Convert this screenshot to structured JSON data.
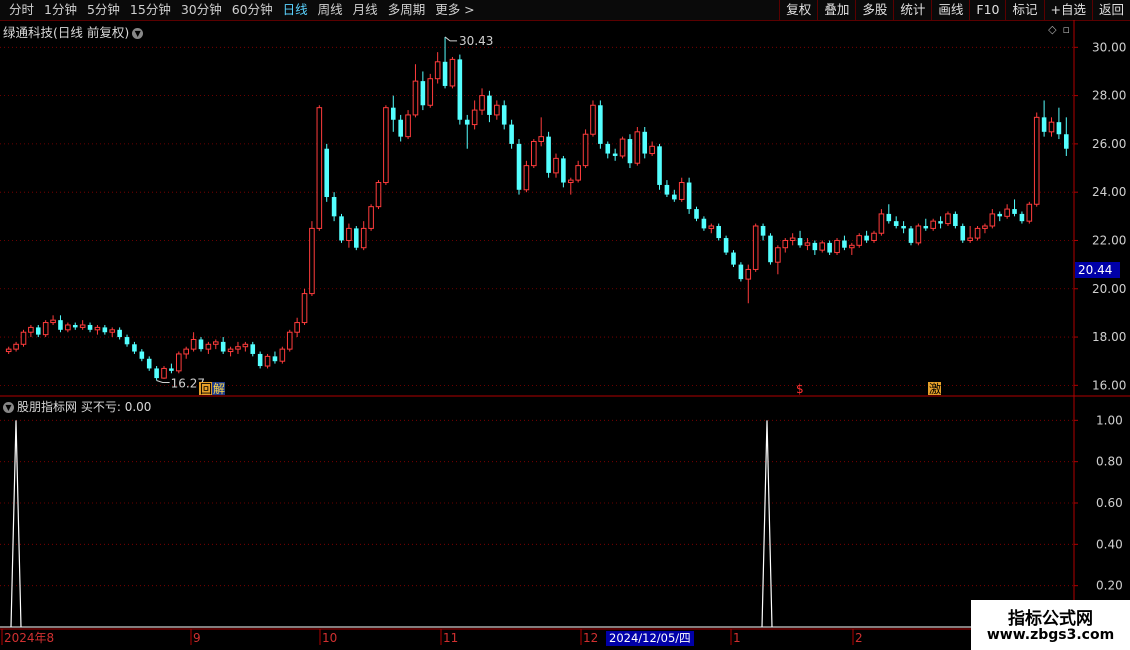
{
  "toolbar": {
    "periods": [
      "分时",
      "1分钟",
      "5分钟",
      "15分钟",
      "30分钟",
      "60分钟",
      "日线",
      "周线",
      "月线",
      "多周期",
      "更多 >"
    ],
    "active_period": "日线",
    "right_buttons": [
      "复权",
      "叠加",
      "多股",
      "统计",
      "画线",
      "F10",
      "标记",
      "+自选",
      "返回"
    ]
  },
  "chart_header": {
    "title": "绿通科技(日线 前复权)"
  },
  "indicator_header": {
    "name": "股朋指标网",
    "label": "买不亏:",
    "value": "0.00"
  },
  "price_axis": {
    "ticks": [
      "30.00",
      "28.00",
      "26.00",
      "24.00",
      "22.00",
      "20.00",
      "18.00",
      "16.00"
    ]
  },
  "indicator_axis": {
    "ticks": [
      "1.00",
      "0.80",
      "0.60",
      "0.40",
      "0.20"
    ]
  },
  "current_price": "20.44",
  "annotations": {
    "high": "30.43",
    "low": "16.27"
  },
  "markers": {
    "hui": "回",
    "jie": "解",
    "dollar": "$",
    "ji": "激"
  },
  "date_axis": [
    "2024年8",
    "9",
    "10",
    "11",
    "12",
    "1",
    "2"
  ],
  "crosshair_date": "2024/12/05/四",
  "watermark": {
    "line1": "指标公式网",
    "line2": "www.zbgs3.com"
  },
  "colors": {
    "up": "#ff3c3c",
    "down": "#54ffff",
    "grid": "#8a0000",
    "active": "#5ad2ff",
    "badge": "#0000a8"
  },
  "chart_data": {
    "type": "candlestick",
    "price_range": [
      15.6,
      30.8
    ],
    "indicator_range": [
      0,
      1.05
    ],
    "candles": [
      [
        17.4,
        17.6,
        17.3,
        17.5
      ],
      [
        17.5,
        17.8,
        17.4,
        17.7
      ],
      [
        17.7,
        18.3,
        17.6,
        18.2
      ],
      [
        18.2,
        18.5,
        18.0,
        18.4
      ],
      [
        18.4,
        18.5,
        18.0,
        18.1
      ],
      [
        18.1,
        18.7,
        18.0,
        18.6
      ],
      [
        18.6,
        18.9,
        18.5,
        18.7
      ],
      [
        18.7,
        18.9,
        18.2,
        18.3
      ],
      [
        18.3,
        18.6,
        18.2,
        18.5
      ],
      [
        18.5,
        18.6,
        18.3,
        18.4
      ],
      [
        18.4,
        18.7,
        18.3,
        18.5
      ],
      [
        18.5,
        18.6,
        18.2,
        18.3
      ],
      [
        18.3,
        18.5,
        18.1,
        18.4
      ],
      [
        18.4,
        18.5,
        18.1,
        18.2
      ],
      [
        18.2,
        18.4,
        18.0,
        18.3
      ],
      [
        18.3,
        18.4,
        17.9,
        18.0
      ],
      [
        18.0,
        18.1,
        17.6,
        17.7
      ],
      [
        17.7,
        17.8,
        17.3,
        17.4
      ],
      [
        17.4,
        17.5,
        17.0,
        17.1
      ],
      [
        17.1,
        17.2,
        16.6,
        16.7
      ],
      [
        16.7,
        16.8,
        16.2,
        16.3
      ],
      [
        16.3,
        16.8,
        16.27,
        16.7
      ],
      [
        16.7,
        16.9,
        16.5,
        16.6
      ],
      [
        16.6,
        17.4,
        16.5,
        17.3
      ],
      [
        17.3,
        17.6,
        17.1,
        17.5
      ],
      [
        17.5,
        18.2,
        17.4,
        17.9
      ],
      [
        17.9,
        18.0,
        17.4,
        17.5
      ],
      [
        17.5,
        17.8,
        17.3,
        17.7
      ],
      [
        17.7,
        17.9,
        17.5,
        17.8
      ],
      [
        17.8,
        18.0,
        17.3,
        17.4
      ],
      [
        17.4,
        17.6,
        17.2,
        17.5
      ],
      [
        17.5,
        17.8,
        17.3,
        17.6
      ],
      [
        17.6,
        17.8,
        17.4,
        17.7
      ],
      [
        17.7,
        17.8,
        17.2,
        17.3
      ],
      [
        17.3,
        17.4,
        16.7,
        16.8
      ],
      [
        16.8,
        17.3,
        16.7,
        17.2
      ],
      [
        17.2,
        17.4,
        16.9,
        17.0
      ],
      [
        17.0,
        17.6,
        16.9,
        17.5
      ],
      [
        17.5,
        18.3,
        17.4,
        18.2
      ],
      [
        18.2,
        18.8,
        18.0,
        18.6
      ],
      [
        18.6,
        20.0,
        18.5,
        19.8
      ],
      [
        19.8,
        22.8,
        19.7,
        22.5
      ],
      [
        22.5,
        27.6,
        22.4,
        27.5
      ],
      [
        25.8,
        26.0,
        23.6,
        23.8
      ],
      [
        23.8,
        24.0,
        22.8,
        23.0
      ],
      [
        23.0,
        23.1,
        21.9,
        22.0
      ],
      [
        22.0,
        22.7,
        21.7,
        22.5
      ],
      [
        22.5,
        22.6,
        21.6,
        21.7
      ],
      [
        21.7,
        22.8,
        21.6,
        22.5
      ],
      [
        22.5,
        23.5,
        22.4,
        23.4
      ],
      [
        23.4,
        24.5,
        23.3,
        24.4
      ],
      [
        24.4,
        27.6,
        24.3,
        27.5
      ],
      [
        27.5,
        28.0,
        26.5,
        27.0
      ],
      [
        27.0,
        27.2,
        26.1,
        26.3
      ],
      [
        26.3,
        27.4,
        26.2,
        27.2
      ],
      [
        27.2,
        29.3,
        27.1,
        28.6
      ],
      [
        28.6,
        29.0,
        27.4,
        27.6
      ],
      [
        27.6,
        28.9,
        27.5,
        28.7
      ],
      [
        28.7,
        29.8,
        28.5,
        29.4
      ],
      [
        29.4,
        30.43,
        28.3,
        28.4
      ],
      [
        28.4,
        29.6,
        28.3,
        29.5
      ],
      [
        29.5,
        29.7,
        26.8,
        27.0
      ],
      [
        27.0,
        27.2,
        25.8,
        26.8
      ],
      [
        26.8,
        27.8,
        26.6,
        27.4
      ],
      [
        27.4,
        28.3,
        27.2,
        28.0
      ],
      [
        28.0,
        28.2,
        26.9,
        27.2
      ],
      [
        27.2,
        27.8,
        27.0,
        27.6
      ],
      [
        27.6,
        27.8,
        26.6,
        26.8
      ],
      [
        26.8,
        27.0,
        25.8,
        26.0
      ],
      [
        26.0,
        26.2,
        23.9,
        24.1
      ],
      [
        24.1,
        25.3,
        24.0,
        25.1
      ],
      [
        25.1,
        26.2,
        25.0,
        26.1
      ],
      [
        26.1,
        27.1,
        25.9,
        26.3
      ],
      [
        26.3,
        26.5,
        24.6,
        24.8
      ],
      [
        24.8,
        25.6,
        24.6,
        25.4
      ],
      [
        25.4,
        25.5,
        24.2,
        24.4
      ],
      [
        24.4,
        24.6,
        23.9,
        24.5
      ],
      [
        24.5,
        25.3,
        24.4,
        25.1
      ],
      [
        25.1,
        26.6,
        25.0,
        26.4
      ],
      [
        26.4,
        27.8,
        26.3,
        27.6
      ],
      [
        27.6,
        27.8,
        25.8,
        26.0
      ],
      [
        26.0,
        26.1,
        25.4,
        25.6
      ],
      [
        25.6,
        25.8,
        25.3,
        25.5
      ],
      [
        25.5,
        26.3,
        25.4,
        26.2
      ],
      [
        26.2,
        26.4,
        25.0,
        25.2
      ],
      [
        25.2,
        26.7,
        25.1,
        26.5
      ],
      [
        26.5,
        26.7,
        25.4,
        25.6
      ],
      [
        25.6,
        26.1,
        25.5,
        25.9
      ],
      [
        25.9,
        26.0,
        24.1,
        24.3
      ],
      [
        24.3,
        24.5,
        23.8,
        23.9
      ],
      [
        23.9,
        24.1,
        23.6,
        23.7
      ],
      [
        23.7,
        24.6,
        23.6,
        24.4
      ],
      [
        24.4,
        24.6,
        23.1,
        23.3
      ],
      [
        23.3,
        23.4,
        22.8,
        22.9
      ],
      [
        22.9,
        23.0,
        22.4,
        22.5
      ],
      [
        22.5,
        22.7,
        22.3,
        22.6
      ],
      [
        22.6,
        22.7,
        22.0,
        22.1
      ],
      [
        22.1,
        22.2,
        21.4,
        21.5
      ],
      [
        21.5,
        21.6,
        20.9,
        21.0
      ],
      [
        21.0,
        21.1,
        20.3,
        20.4
      ],
      [
        20.4,
        21.0,
        19.4,
        20.8
      ],
      [
        20.8,
        22.7,
        20.7,
        22.6
      ],
      [
        22.6,
        22.7,
        22.0,
        22.2
      ],
      [
        22.2,
        22.3,
        21.0,
        21.1
      ],
      [
        21.1,
        21.8,
        20.6,
        21.7
      ],
      [
        21.7,
        22.1,
        21.5,
        22.0
      ],
      [
        22.0,
        22.3,
        21.8,
        22.1
      ],
      [
        22.1,
        22.4,
        21.7,
        21.8
      ],
      [
        21.8,
        22.1,
        21.6,
        21.9
      ],
      [
        21.9,
        22.0,
        21.4,
        21.6
      ],
      [
        21.6,
        22.0,
        21.5,
        21.9
      ],
      [
        21.9,
        22.0,
        21.4,
        21.5
      ],
      [
        21.5,
        22.1,
        21.4,
        22.0
      ],
      [
        22.0,
        22.2,
        21.6,
        21.7
      ],
      [
        21.7,
        21.9,
        21.4,
        21.8
      ],
      [
        21.8,
        22.3,
        21.7,
        22.2
      ],
      [
        22.2,
        22.4,
        21.9,
        22.0
      ],
      [
        22.0,
        22.4,
        21.9,
        22.3
      ],
      [
        22.3,
        23.3,
        22.2,
        23.1
      ],
      [
        23.1,
        23.5,
        22.7,
        22.8
      ],
      [
        22.8,
        23.0,
        22.5,
        22.6
      ],
      [
        22.6,
        22.8,
        22.3,
        22.5
      ],
      [
        22.5,
        22.6,
        21.8,
        21.9
      ],
      [
        21.9,
        22.7,
        21.8,
        22.6
      ],
      [
        22.6,
        22.9,
        22.4,
        22.5
      ],
      [
        22.5,
        22.9,
        22.4,
        22.8
      ],
      [
        22.8,
        23.0,
        22.5,
        22.7
      ],
      [
        22.7,
        23.2,
        22.6,
        23.1
      ],
      [
        23.1,
        23.2,
        22.5,
        22.6
      ],
      [
        22.6,
        22.7,
        21.9,
        22.0
      ],
      [
        22.0,
        22.6,
        21.9,
        22.1
      ],
      [
        22.1,
        22.6,
        22.0,
        22.5
      ],
      [
        22.5,
        22.7,
        22.3,
        22.6
      ],
      [
        22.6,
        23.3,
        22.5,
        23.1
      ],
      [
        23.1,
        23.2,
        22.8,
        23.0
      ],
      [
        23.0,
        23.5,
        22.9,
        23.3
      ],
      [
        23.3,
        23.7,
        23.0,
        23.1
      ],
      [
        23.1,
        23.2,
        22.7,
        22.8
      ],
      [
        22.8,
        23.6,
        22.7,
        23.5
      ],
      [
        23.5,
        27.3,
        23.4,
        27.1
      ],
      [
        27.1,
        27.8,
        26.3,
        26.5
      ],
      [
        26.5,
        27.1,
        26.3,
        26.9
      ],
      [
        26.9,
        27.5,
        26.2,
        26.4
      ],
      [
        26.4,
        27.1,
        25.5,
        25.8
      ]
    ],
    "indicator_peaks": [
      1.0,
      1.0
    ]
  }
}
